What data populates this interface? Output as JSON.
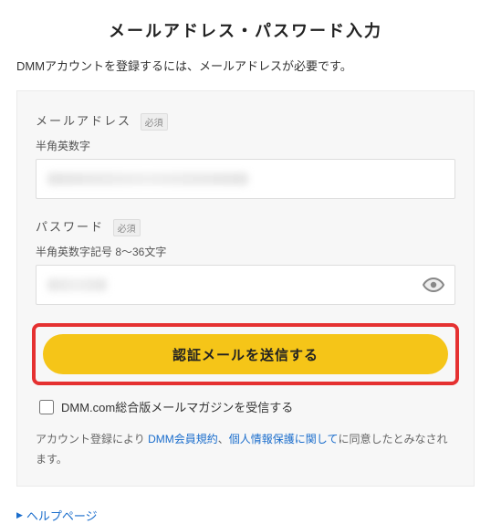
{
  "page": {
    "title": "メールアドレス・パスワード入力",
    "subtitle": "DMMアカウントを登録するには、メールアドレスが必要です。"
  },
  "form": {
    "email": {
      "label": "メールアドレス",
      "required_badge": "必須",
      "hint": "半角英数字",
      "value": ""
    },
    "password": {
      "label": "パスワード",
      "required_badge": "必須",
      "hint": "半角英数字記号 8～36文字",
      "value": ""
    },
    "submit_label": "認証メールを送信する",
    "newsletter": {
      "label": "DMM.com総合版メールマガジンを受信する",
      "checked": false
    },
    "terms": {
      "prefix": "アカウント登録により ",
      "link1": "DMM会員規約",
      "sep": "、",
      "link2": "個人情報保護に関して",
      "suffix": "に同意したとみなされます。"
    }
  },
  "help": {
    "label": "ヘルプページ"
  },
  "colors": {
    "accent_button": "#f5c518",
    "highlight_border": "#e53131",
    "link": "#1a6dcc"
  }
}
